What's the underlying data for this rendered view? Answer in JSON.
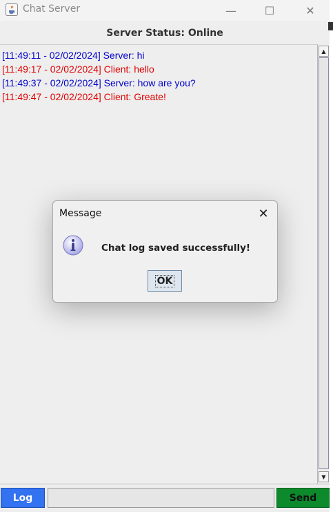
{
  "window": {
    "title": "Chat Server",
    "controls": {
      "minimize": "—",
      "maximize": "☐",
      "close": "✕"
    }
  },
  "status": {
    "text": "Server Status: Online"
  },
  "chat": {
    "messages": [
      {
        "text": "[11:49:11 - 02/02/2024] Server: hi",
        "sender": "server",
        "color": "#0000cc"
      },
      {
        "text": "[11:49:17 - 02/02/2024] Client: hello",
        "sender": "client",
        "color": "#e00000"
      },
      {
        "text": "[11:49:37 - 02/02/2024] Server: how are you?",
        "sender": "server",
        "color": "#0000cc"
      },
      {
        "text": "[11:49:47 - 02/02/2024] Client: Greate!",
        "sender": "client",
        "color": "#e00000"
      }
    ]
  },
  "bottom": {
    "log_label": "Log",
    "input_value": "",
    "send_label": "Send",
    "log_color": "#3372f0",
    "send_color": "#0c8a2c"
  },
  "dialog": {
    "title": "Message",
    "message": "Chat log saved successfully!",
    "ok_label": "OK",
    "close_glyph": "✕",
    "icon": "info-icon"
  },
  "scrollbar": {
    "up_glyph": "▲",
    "down_glyph": "▼"
  }
}
